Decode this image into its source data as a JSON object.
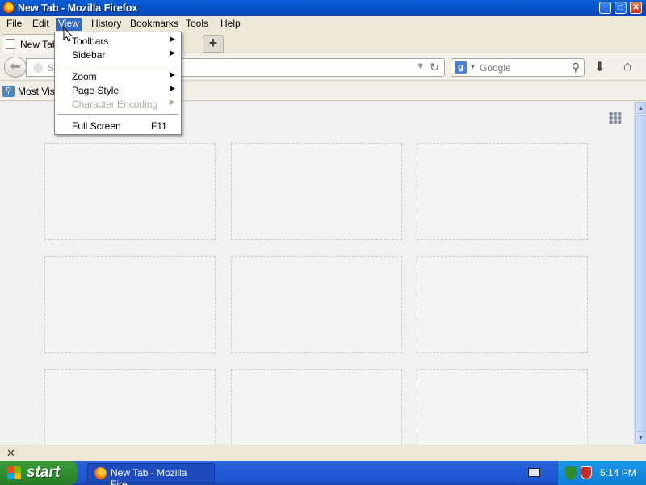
{
  "window": {
    "title": "New Tab - Mozilla Firefox",
    "min": "_",
    "max": "□",
    "close": "✕"
  },
  "menubar": {
    "items": [
      {
        "label": "File"
      },
      {
        "label": "Edit"
      },
      {
        "label": "View"
      },
      {
        "label": "History"
      },
      {
        "label": "Bookmarks"
      },
      {
        "label": "Tools"
      },
      {
        "label": "Help"
      }
    ]
  },
  "view_menu": {
    "items": [
      {
        "label": "Toolbars",
        "arrow": "▶"
      },
      {
        "label": "Sidebar",
        "arrow": "▶"
      },
      {
        "label": "Zoom",
        "arrow": "▶"
      },
      {
        "label": "Page Style",
        "arrow": "▶"
      },
      {
        "label": "Character Encoding",
        "arrow": "▶"
      },
      {
        "label": "Full Screen",
        "shortcut": "F11"
      }
    ]
  },
  "tabs": {
    "active_label": "New Tab",
    "new_tab": "+"
  },
  "navbar": {
    "back": "⬅",
    "url_text": "S",
    "url_drop": "▼",
    "reload": "↻",
    "search_engine": "g",
    "search_drop": "▼",
    "search_placeholder": "Google",
    "search_go": "⚲",
    "download": "⬇",
    "home": "⌂"
  },
  "bookmarks": {
    "most_visited": "Most Visi",
    "icon": "⚲"
  },
  "scrollbar": {
    "up": "▲",
    "down": "▼"
  },
  "addonbar": {
    "close": "✕"
  },
  "taskbar": {
    "start": "start",
    "task_label": "New Tab - Mozilla Fire...",
    "clock": "5:14 PM"
  }
}
